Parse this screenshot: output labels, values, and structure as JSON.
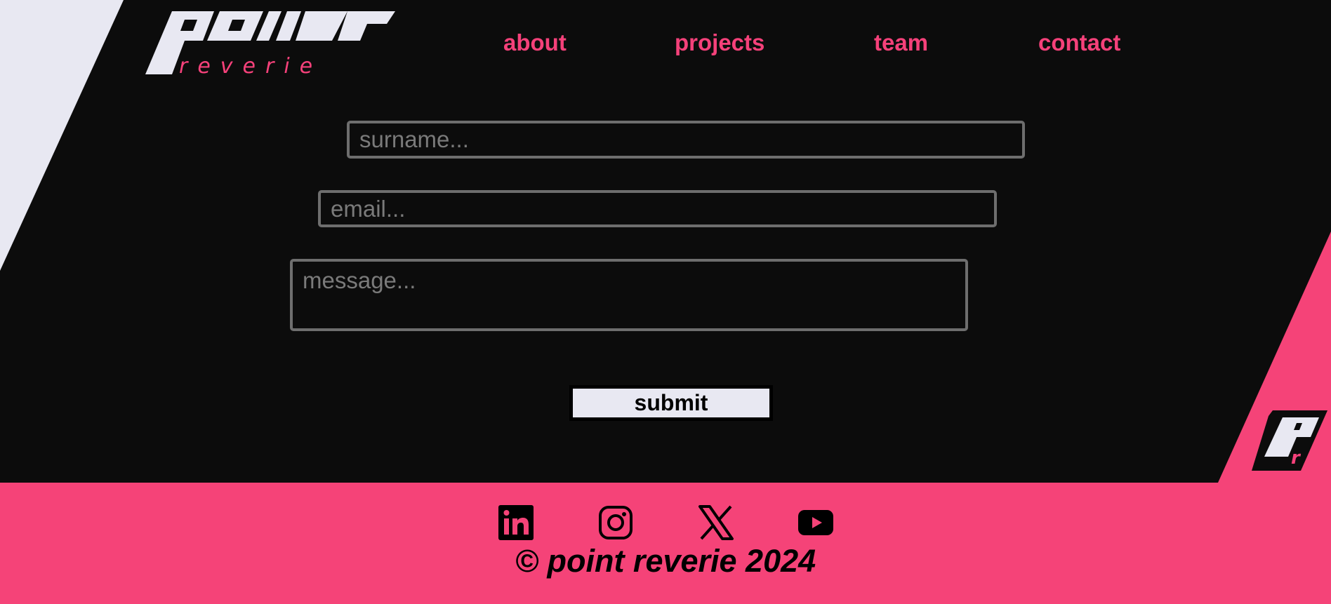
{
  "brand": {
    "logo_text": "POINT",
    "logo_subtext": "reverie",
    "corner_logo_text": "Pr"
  },
  "nav": {
    "items": [
      {
        "label": "about"
      },
      {
        "label": "projects"
      },
      {
        "label": "team"
      },
      {
        "label": "contact"
      }
    ]
  },
  "form": {
    "surname_placeholder": "surname...",
    "email_placeholder": "email...",
    "message_placeholder": "message...",
    "submit_label": "submit"
  },
  "footer": {
    "social": [
      {
        "icon": "linkedin-icon"
      },
      {
        "icon": "instagram-icon"
      },
      {
        "icon": "x-icon"
      },
      {
        "icon": "youtube-icon"
      }
    ],
    "copyright": "© point reverie 2024"
  },
  "colors": {
    "accent": "#f5417a",
    "background": "#0c0c0c",
    "light": "#e8e8f2",
    "footer": "#f54378",
    "input_border": "#6e6e6e"
  }
}
